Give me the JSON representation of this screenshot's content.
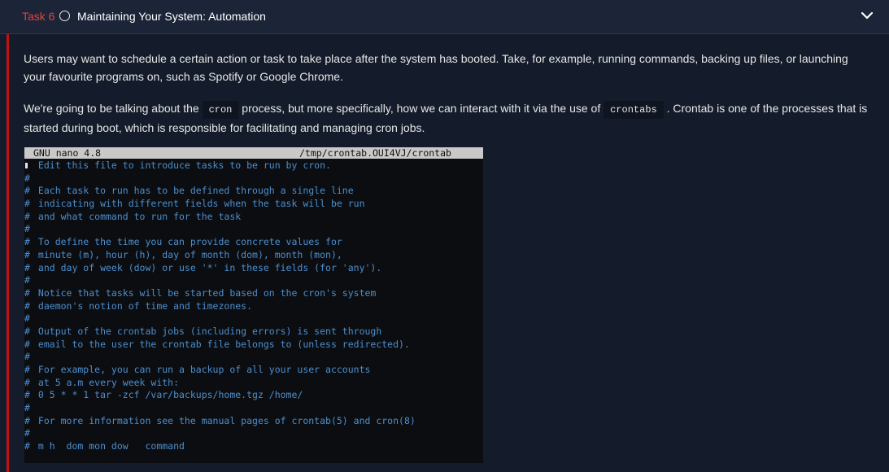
{
  "task": {
    "number_label": "Task 6",
    "title": "Maintaining Your System: Automation",
    "status_icon": "circle-outline-icon",
    "toggle_icon": "chevron-down-icon"
  },
  "content": {
    "paragraph1": "Users may want to schedule a certain action or task to take place after the system has booted. Take, for example, running commands, backing up files, or launching your favourite programs on, such as Spotify or Google Chrome.",
    "paragraph2_part1": "We're going to be talking about the ",
    "code_cron": "cron",
    "paragraph2_part2": " process, but more specifically, how we can interact with it via the use of ",
    "code_crontabs": "crontabs",
    "paragraph2_part3": " . Crontab is one of the processes that is started during boot, which is responsible for facilitating and managing cron jobs."
  },
  "terminal": {
    "app": "GNU nano 4.8",
    "file": "/tmp/crontab.OUI4VJ/crontab",
    "lines": [
      "Edit this file to introduce tasks to be run by cron.",
      "",
      "Each task to run has to be defined through a single line",
      "indicating with different fields when the task will be run",
      "and what command to run for the task",
      "",
      "To define the time you can provide concrete values for",
      "minute (m), hour (h), day of month (dom), month (mon),",
      "and day of week (dow) or use '*' in these fields (for 'any').",
      "",
      "Notice that tasks will be started based on the cron's system",
      "daemon's notion of time and timezones.",
      "",
      "Output of the crontab jobs (including errors) is sent through",
      "email to the user the crontab file belongs to (unless redirected).",
      "",
      "For example, you can run a backup of all your user accounts",
      "at 5 a.m every week with:",
      "0 5 * * 1 tar -zcf /var/backups/home.tgz /home/",
      "",
      "For more information see the manual pages of crontab(5) and cron(8)",
      "",
      "m h  dom mon dow   command"
    ]
  },
  "colors": {
    "accent_red": "#e0423c",
    "left_bar": "#c11111",
    "terminal_text": "#4c8fcf"
  }
}
